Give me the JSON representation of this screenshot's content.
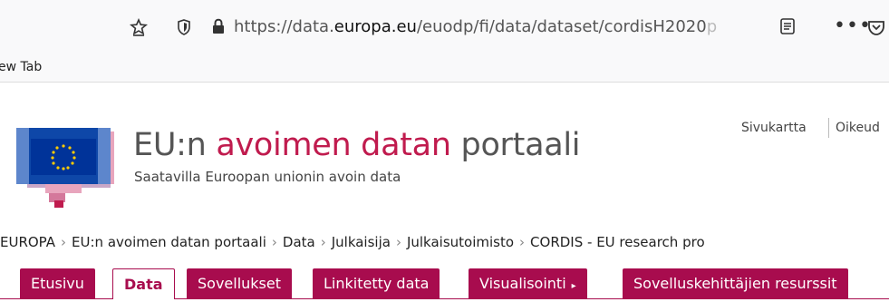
{
  "browser": {
    "url_prefix": "https://data.",
    "url_domain": "europa.eu",
    "url_path": "/euodp/fi/data/dataset/cordisH2020",
    "url_fade": "p",
    "more_label": "•••",
    "bookmark_tab": "ew Tab"
  },
  "utility_links": [
    "Sivukartta",
    "Oikeud"
  ],
  "header": {
    "title_prefix": "EU:n ",
    "title_accent": "avoimen datan",
    "title_suffix": " portaali",
    "subtitle": "Saatavilla Euroopan unionin avoin data"
  },
  "breadcrumb": [
    "EUROPA",
    "EU:n avoimen datan portaali",
    "Data",
    "Julkaisija",
    "Julkaisutoimisto",
    "CORDIS - EU research pro"
  ],
  "breadcrumb_sep": "›",
  "nav": {
    "tabs": [
      {
        "label": "Etusivu"
      },
      {
        "label": "Data"
      },
      {
        "label": "Sovellukset"
      },
      {
        "label": "Linkitetty data"
      },
      {
        "label": "Visualisointi"
      },
      {
        "label": "Sovelluskehittäjien resurssit"
      }
    ],
    "dropdown_arrow": "▸"
  },
  "colors": {
    "accent": "#a80c4e",
    "title_accent": "#c01b4e",
    "logo_blue": "#003399",
    "logo_pink": "#e8a5bd"
  }
}
